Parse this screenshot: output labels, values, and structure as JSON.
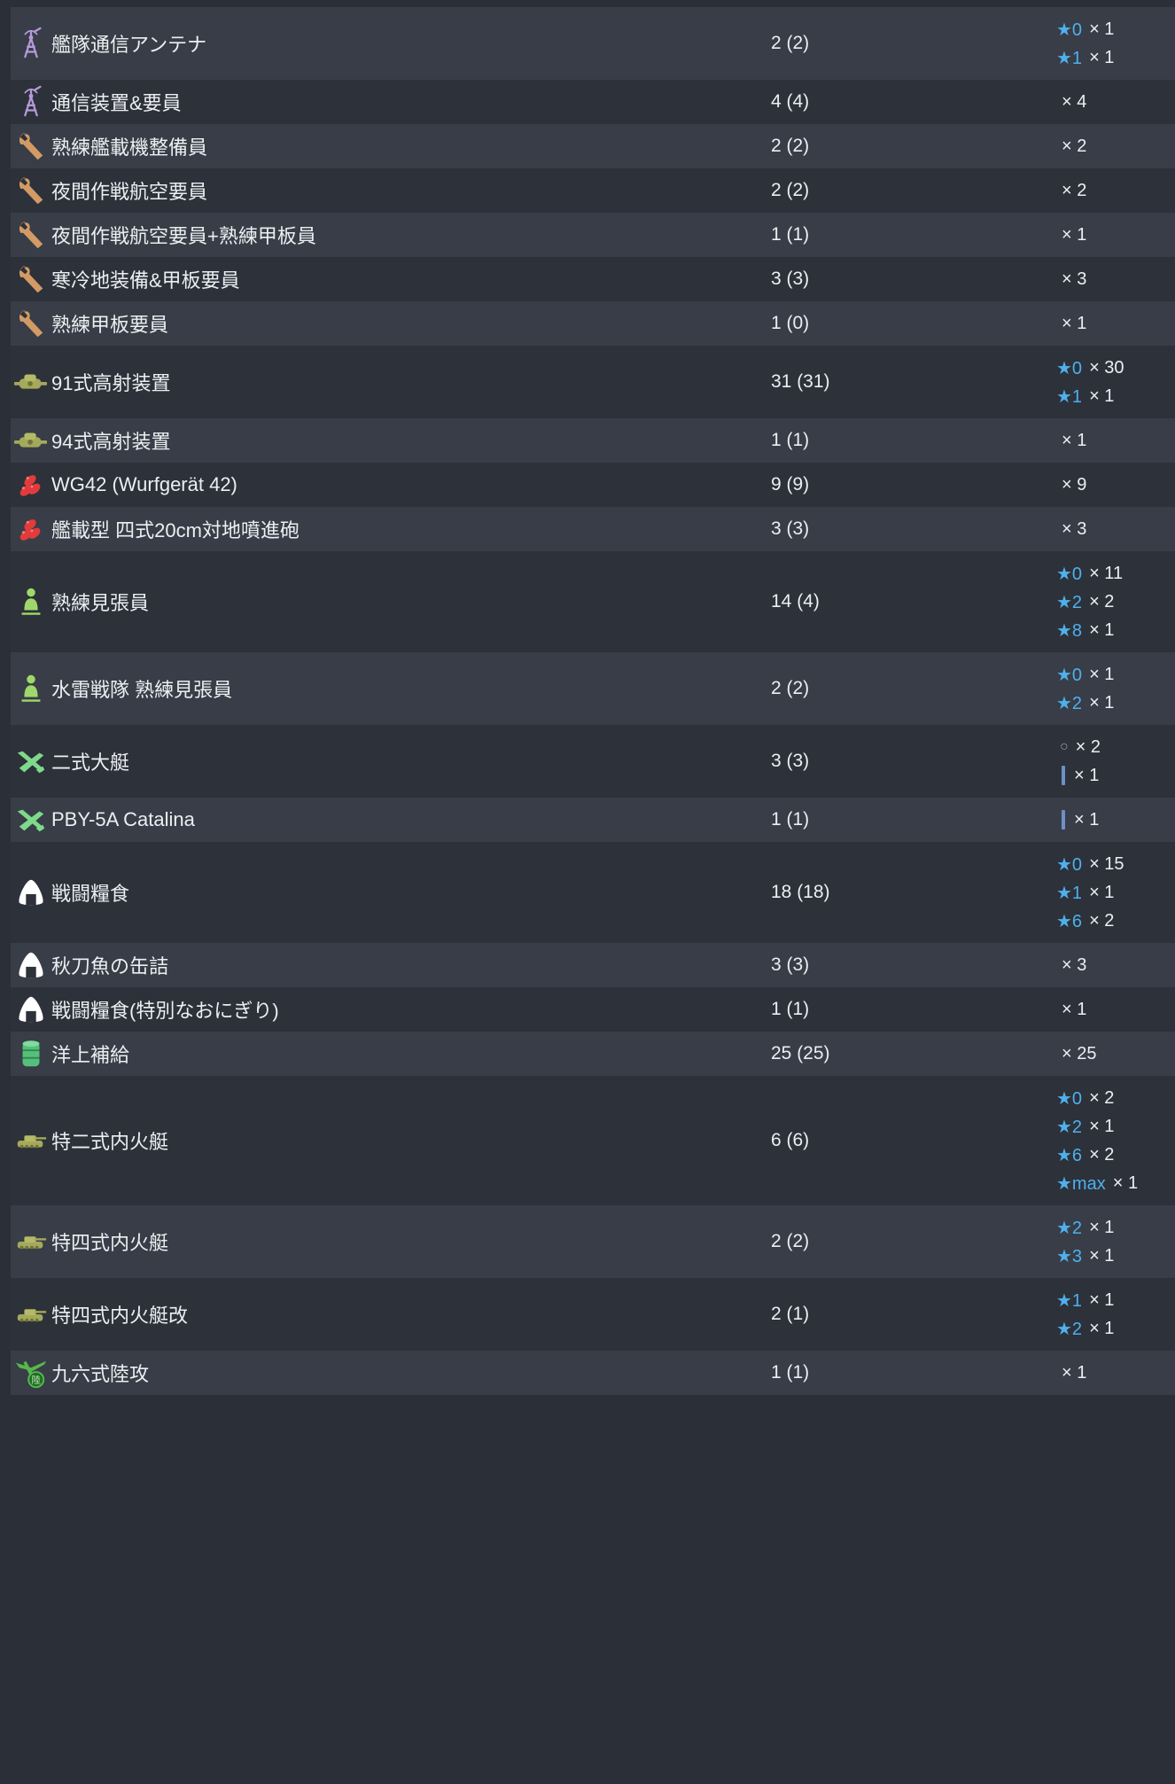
{
  "rows": [
    {
      "name": "艦隊通信アンテナ",
      "count": "2 (2)",
      "icon": "antenna-icon",
      "levels": [
        {
          "kind": "star",
          "level": "★0",
          "mult": "× 1"
        },
        {
          "kind": "star",
          "level": "★1",
          "mult": "× 1"
        }
      ]
    },
    {
      "name": "通信装置&要員",
      "count": "4 (4)",
      "icon": "antenna-icon",
      "levels": [
        {
          "kind": "plain",
          "level": "",
          "mult": "× 4"
        }
      ]
    },
    {
      "name": "熟練艦載機整備員",
      "count": "2 (2)",
      "icon": "wrench-icon",
      "levels": [
        {
          "kind": "plain",
          "level": "",
          "mult": "× 2"
        }
      ]
    },
    {
      "name": "夜間作戦航空要員",
      "count": "2 (2)",
      "icon": "wrench-icon",
      "levels": [
        {
          "kind": "plain",
          "level": "",
          "mult": "× 2"
        }
      ]
    },
    {
      "name": "夜間作戦航空要員+熟練甲板員",
      "count": "1 (1)",
      "icon": "wrench-icon",
      "levels": [
        {
          "kind": "plain",
          "level": "",
          "mult": "× 1"
        }
      ]
    },
    {
      "name": "寒冷地装備&甲板要員",
      "count": "3 (3)",
      "icon": "wrench-icon",
      "levels": [
        {
          "kind": "plain",
          "level": "",
          "mult": "× 3"
        }
      ]
    },
    {
      "name": "熟練甲板要員",
      "count": "1 (0)",
      "icon": "wrench-icon",
      "levels": [
        {
          "kind": "plain",
          "level": "",
          "mult": "× 1"
        }
      ]
    },
    {
      "name": "91式高射装置",
      "count": "31 (31)",
      "icon": "aa-director-icon",
      "levels": [
        {
          "kind": "star",
          "level": "★0",
          "mult": "× 30"
        },
        {
          "kind": "star",
          "level": "★1",
          "mult": "× 1"
        }
      ]
    },
    {
      "name": "94式高射装置",
      "count": "1 (1)",
      "icon": "aa-director-icon",
      "levels": [
        {
          "kind": "plain",
          "level": "",
          "mult": "× 1"
        }
      ]
    },
    {
      "name": "WG42 (Wurfgerät 42)",
      "count": "9 (9)",
      "icon": "rocket-launcher-icon",
      "levels": [
        {
          "kind": "plain",
          "level": "",
          "mult": "× 9"
        }
      ]
    },
    {
      "name": "艦載型 四式20cm対地噴進砲",
      "count": "3 (3)",
      "icon": "rocket-launcher-icon",
      "levels": [
        {
          "kind": "plain",
          "level": "",
          "mult": "× 3"
        }
      ]
    },
    {
      "name": "熟練見張員",
      "count": "14 (4)",
      "icon": "lookout-icon",
      "levels": [
        {
          "kind": "star",
          "level": "★0",
          "mult": "× 11"
        },
        {
          "kind": "star",
          "level": "★2",
          "mult": "× 2"
        },
        {
          "kind": "star",
          "level": "★8",
          "mult": "× 1"
        }
      ]
    },
    {
      "name": "水雷戦隊 熟練見張員",
      "count": "2 (2)",
      "icon": "lookout-icon",
      "levels": [
        {
          "kind": "star",
          "level": "★0",
          "mult": "× 1"
        },
        {
          "kind": "star",
          "level": "★2",
          "mult": "× 1"
        }
      ]
    },
    {
      "name": "二式大艇",
      "count": "3 (3)",
      "icon": "flying-boat-icon",
      "levels": [
        {
          "kind": "ring",
          "level": "○",
          "mult": "× 2"
        },
        {
          "kind": "bar",
          "level": "",
          "mult": "× 1"
        }
      ]
    },
    {
      "name": "PBY-5A Catalina",
      "count": "1 (1)",
      "icon": "flying-boat-icon",
      "levels": [
        {
          "kind": "bar",
          "level": "",
          "mult": "× 1"
        }
      ]
    },
    {
      "name": "戦闘糧食",
      "count": "18 (18)",
      "icon": "onigiri-icon",
      "levels": [
        {
          "kind": "star",
          "level": "★0",
          "mult": "× 15"
        },
        {
          "kind": "star",
          "level": "★1",
          "mult": "× 1"
        },
        {
          "kind": "star",
          "level": "★6",
          "mult": "× 2"
        }
      ]
    },
    {
      "name": "秋刀魚の缶詰",
      "count": "3 (3)",
      "icon": "onigiri-icon",
      "levels": [
        {
          "kind": "plain",
          "level": "",
          "mult": "× 3"
        }
      ]
    },
    {
      "name": "戦闘糧食(特別なおにぎり)",
      "count": "1 (1)",
      "icon": "onigiri-icon",
      "levels": [
        {
          "kind": "plain",
          "level": "",
          "mult": "× 1"
        }
      ]
    },
    {
      "name": "洋上補給",
      "count": "25 (25)",
      "icon": "drum-icon",
      "levels": [
        {
          "kind": "plain",
          "level": "",
          "mult": "× 25"
        }
      ]
    },
    {
      "name": "特二式内火艇",
      "count": "6 (6)",
      "icon": "amphibious-tank-icon",
      "levels": [
        {
          "kind": "star",
          "level": "★0",
          "mult": "× 2"
        },
        {
          "kind": "star",
          "level": "★2",
          "mult": "× 1"
        },
        {
          "kind": "star",
          "level": "★6",
          "mult": "× 2"
        },
        {
          "kind": "star",
          "level": "★max",
          "mult": "× 1"
        }
      ]
    },
    {
      "name": "特四式内火艇",
      "count": "2 (2)",
      "icon": "amphibious-tank-icon",
      "levels": [
        {
          "kind": "star",
          "level": "★2",
          "mult": "× 1"
        },
        {
          "kind": "star",
          "level": "★3",
          "mult": "× 1"
        }
      ]
    },
    {
      "name": "特四式内火艇改",
      "count": "2 (1)",
      "icon": "amphibious-tank-icon",
      "levels": [
        {
          "kind": "star",
          "level": "★1",
          "mult": "× 1"
        },
        {
          "kind": "star",
          "level": "★2",
          "mult": "× 1"
        }
      ]
    },
    {
      "name": "九六式陸攻",
      "count": "1 (1)",
      "icon": "land-bomber-icon",
      "icon_text": "陸",
      "levels": [
        {
          "kind": "plain",
          "level": "",
          "mult": "× 1"
        }
      ]
    }
  ],
  "colors": {
    "row_odd": "#383d47",
    "row_even": "#2d313a",
    "star_level": "#4fb0ec",
    "text": "#eceef1"
  }
}
